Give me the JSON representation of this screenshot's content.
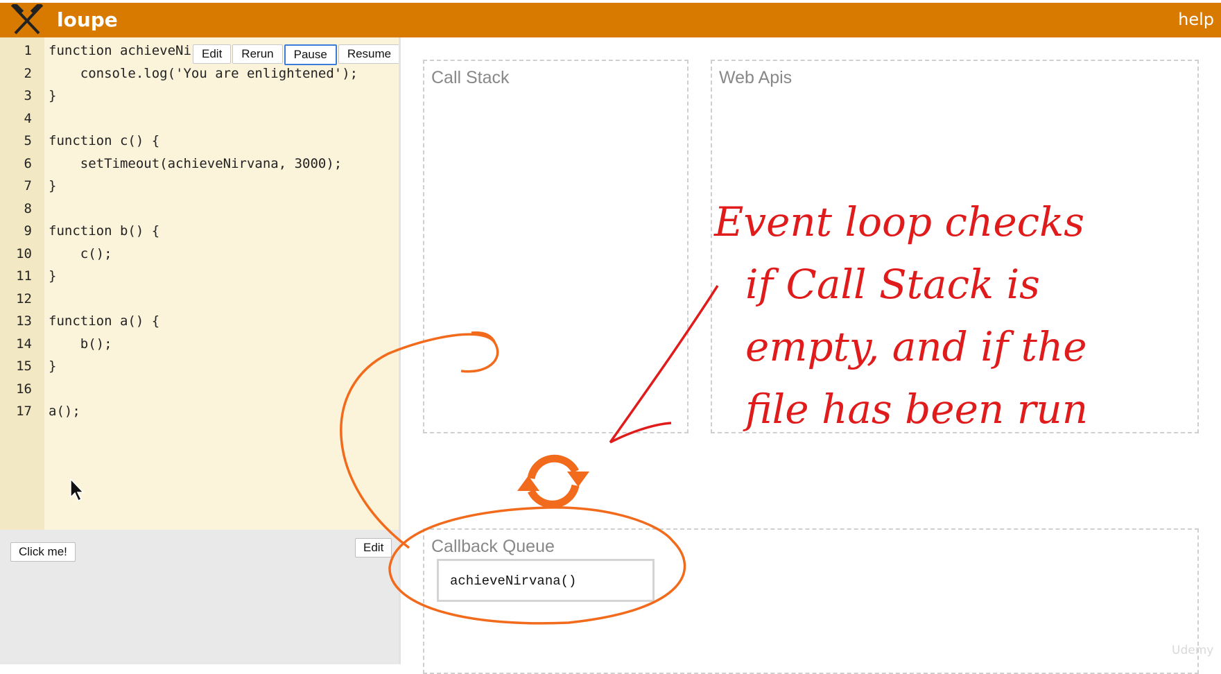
{
  "header": {
    "title": "loupe",
    "help_label": "help",
    "bg_color": "#d97a00"
  },
  "editor": {
    "toolbar": {
      "edit_label": "Edit",
      "rerun_label": "Rerun",
      "pause_label": "Pause",
      "resume_label": "Resume"
    },
    "lines": [
      {
        "num": "1",
        "text": "function achieveNir"
      },
      {
        "num": "2",
        "text": "    console.log('You are enlightened');"
      },
      {
        "num": "3",
        "text": "}"
      },
      {
        "num": "4",
        "text": ""
      },
      {
        "num": "5",
        "text": "function c() {"
      },
      {
        "num": "6",
        "text": "    setTimeout(achieveNirvana, 3000);"
      },
      {
        "num": "7",
        "text": "}"
      },
      {
        "num": "8",
        "text": ""
      },
      {
        "num": "9",
        "text": "function b() {"
      },
      {
        "num": "10",
        "text": "    c();"
      },
      {
        "num": "11",
        "text": "}"
      },
      {
        "num": "12",
        "text": ""
      },
      {
        "num": "13",
        "text": "function a() {"
      },
      {
        "num": "14",
        "text": "    b();"
      },
      {
        "num": "15",
        "text": "}"
      },
      {
        "num": "16",
        "text": ""
      },
      {
        "num": "17",
        "text": "a();"
      }
    ]
  },
  "html_panel": {
    "click_button_label": "Click me!",
    "edit_label": "Edit"
  },
  "panels": {
    "call_stack_title": "Call Stack",
    "web_apis_title": "Web Apis",
    "callback_queue_title": "Callback Queue",
    "queue_items": [
      "achieveNirvana()"
    ]
  },
  "annotation": {
    "lines": [
      "Event loop checks",
      "if Call Stack is",
      "empty, and if the",
      "file has been run"
    ],
    "color": "#e01b1b",
    "circle_color": "#f26a1b"
  },
  "watermark": "Udemy",
  "icons": {
    "logo": "crossed-hammers-icon",
    "loop": "event-loop-arrows-icon",
    "cursor": "mouse-pointer-icon"
  }
}
